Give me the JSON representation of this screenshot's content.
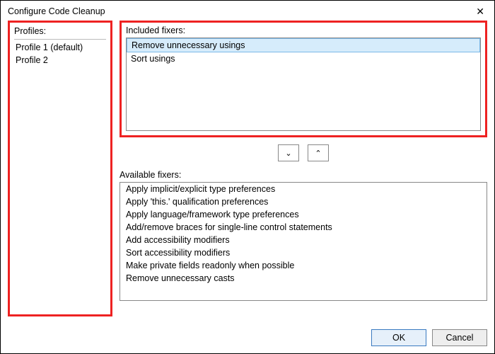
{
  "titlebar": {
    "title": "Configure Code Cleanup",
    "close": "✕"
  },
  "profiles": {
    "label": "Profiles:",
    "items": [
      {
        "label": "Profile 1 (default)",
        "selected": true
      },
      {
        "label": "Profile 2",
        "selected": false
      }
    ]
  },
  "included": {
    "label": "Included fixers:",
    "items": [
      {
        "label": "Remove unnecessary usings",
        "selected": true
      },
      {
        "label": "Sort usings",
        "selected": false
      }
    ]
  },
  "arrows": {
    "down": "⌄",
    "up": "⌃"
  },
  "available": {
    "label": "Available fixers:",
    "items": [
      {
        "label": "Apply implicit/explicit type preferences"
      },
      {
        "label": "Apply 'this.' qualification preferences"
      },
      {
        "label": "Apply language/framework type preferences"
      },
      {
        "label": "Add/remove braces for single-line control statements"
      },
      {
        "label": "Add accessibility modifiers"
      },
      {
        "label": "Sort accessibility modifiers"
      },
      {
        "label": "Make private fields readonly when possible"
      },
      {
        "label": "Remove unnecessary casts"
      }
    ]
  },
  "footer": {
    "ok": "OK",
    "cancel": "Cancel"
  }
}
